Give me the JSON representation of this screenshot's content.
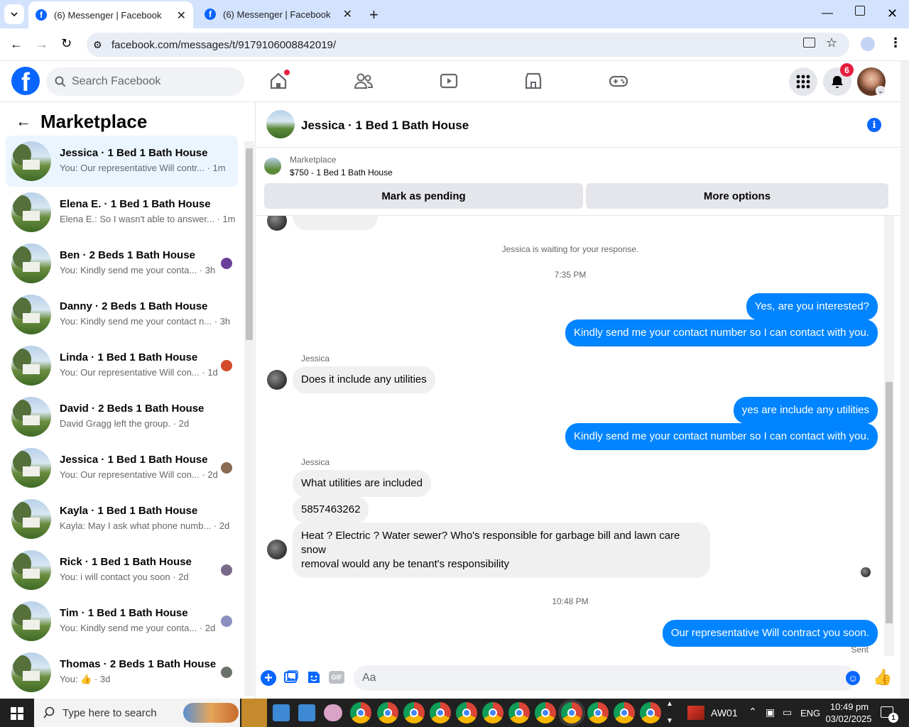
{
  "browser": {
    "tabs": [
      {
        "title": "(6) Messenger | Facebook",
        "active": true
      },
      {
        "title": "(6) Messenger | Facebook",
        "active": false
      }
    ],
    "url": "facebook.com/messages/t/9179106008842019/"
  },
  "fbnav": {
    "search_placeholder": "Search Facebook",
    "notification_count": "6",
    "brand_color": "#0866ff"
  },
  "sidebar": {
    "title": "Marketplace",
    "conversations": [
      {
        "name": "Jessica · 1 Bed 1 Bath House",
        "preview": "You: Our representative Will contr... · 1m",
        "selected": true
      },
      {
        "name": "Elena E. · 1 Bed 1 Bath House",
        "preview": "Elena E.: So I wasn't able to answer... · 1m"
      },
      {
        "name": "Ben · 2 Beds 1 Bath House",
        "preview": "You: Kindly send me your conta... · 3h"
      },
      {
        "name": "Danny · 2 Beds 1 Bath House",
        "preview": "You: Kindly send me your contact n... · 3h"
      },
      {
        "name": "Linda · 1 Bed 1 Bath House",
        "preview": "You: Our representative Will con... · 1d"
      },
      {
        "name": "David · 2 Beds 1 Bath House",
        "preview": "David Gragg left the group. · 2d"
      },
      {
        "name": "Jessica · 1 Bed 1 Bath House",
        "preview": "You: Our representative Will con... · 2d"
      },
      {
        "name": "Kayla · 1 Bed 1 Bath House",
        "preview": "Kayla: May I ask what phone numb... · 2d"
      },
      {
        "name": "Rick · 1 Bed 1 Bath House",
        "preview": "You: i will contact you soon · 2d"
      },
      {
        "name": "Tim · 1 Bed 1 Bath House",
        "preview": "You: Kindly send me your conta... · 2d"
      },
      {
        "name": "Thomas · 2 Beds 1 Bath House",
        "preview": "You: 👍 · 3d"
      }
    ]
  },
  "chat": {
    "title": "Jessica · 1 Bed 1 Bath House",
    "marketplace_label": "Marketplace",
    "listing": "$750 - 1 Bed 1 Bath House",
    "mark_pending": "Mark as pending",
    "more_options": "More options",
    "waiting": "Jessica is waiting for your response.",
    "time1": "7:35 PM",
    "time2": "10:48 PM",
    "sender_name": "Jessica",
    "messages": {
      "m1": "Yes, are you interested?",
      "m2": "Kindly send me your contact number so I can contact with you.",
      "m3": "Does it include any utilities",
      "m4": "yes are include any utilities",
      "m5": "Kindly send me your contact number so I can contact with you.",
      "m6": "What utilities are included",
      "m7": "5857463262",
      "m8a": "Heat ? Electric ? Water sewer? Who's responsible for garbage bill and lawn care snow",
      "m8b": "removal would any be tenant's responsibility",
      "m9": "Our representative Will contract you soon."
    },
    "sent": "Sent",
    "composer_placeholder": "Aa",
    "accent": "#0084ff"
  },
  "taskbar": {
    "search_placeholder": "Type here to search",
    "user": "AW01",
    "lang": "ENG",
    "time": "10:49 pm",
    "date": "03/02/2025",
    "notif": "1"
  }
}
